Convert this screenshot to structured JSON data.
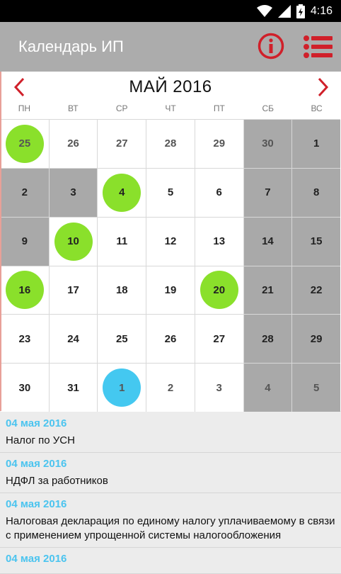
{
  "status_bar": {
    "time": "4:16"
  },
  "app_bar": {
    "title": "Календарь ИП",
    "accent": "#d0202a"
  },
  "calendar": {
    "month_title": "МАЙ 2016",
    "weekdays": [
      "ПН",
      "ВТ",
      "СР",
      "ЧТ",
      "ПТ",
      "СБ",
      "ВС"
    ],
    "colors": {
      "green": "#8ae02b",
      "blue": "#44c8f0",
      "gray": "#a9a9a9"
    },
    "weeks": [
      [
        {
          "d": "25",
          "gray": false,
          "other": true,
          "mark": "green"
        },
        {
          "d": "26",
          "gray": false,
          "other": true,
          "mark": null
        },
        {
          "d": "27",
          "gray": false,
          "other": true,
          "mark": null
        },
        {
          "d": "28",
          "gray": false,
          "other": true,
          "mark": null
        },
        {
          "d": "29",
          "gray": false,
          "other": true,
          "mark": null
        },
        {
          "d": "30",
          "gray": true,
          "other": true,
          "mark": null
        },
        {
          "d": "1",
          "gray": true,
          "other": false,
          "mark": null
        }
      ],
      [
        {
          "d": "2",
          "gray": true,
          "other": false,
          "mark": null
        },
        {
          "d": "3",
          "gray": true,
          "other": false,
          "mark": null
        },
        {
          "d": "4",
          "gray": false,
          "other": false,
          "mark": "green"
        },
        {
          "d": "5",
          "gray": false,
          "other": false,
          "mark": null
        },
        {
          "d": "6",
          "gray": false,
          "other": false,
          "mark": null
        },
        {
          "d": "7",
          "gray": true,
          "other": false,
          "mark": null
        },
        {
          "d": "8",
          "gray": true,
          "other": false,
          "mark": null
        }
      ],
      [
        {
          "d": "9",
          "gray": true,
          "other": false,
          "mark": null
        },
        {
          "d": "10",
          "gray": false,
          "other": false,
          "mark": "green"
        },
        {
          "d": "11",
          "gray": false,
          "other": false,
          "mark": null
        },
        {
          "d": "12",
          "gray": false,
          "other": false,
          "mark": null
        },
        {
          "d": "13",
          "gray": false,
          "other": false,
          "mark": null
        },
        {
          "d": "14",
          "gray": true,
          "other": false,
          "mark": null
        },
        {
          "d": "15",
          "gray": true,
          "other": false,
          "mark": null
        }
      ],
      [
        {
          "d": "16",
          "gray": false,
          "other": false,
          "mark": "green"
        },
        {
          "d": "17",
          "gray": false,
          "other": false,
          "mark": null
        },
        {
          "d": "18",
          "gray": false,
          "other": false,
          "mark": null
        },
        {
          "d": "19",
          "gray": false,
          "other": false,
          "mark": null
        },
        {
          "d": "20",
          "gray": false,
          "other": false,
          "mark": "green"
        },
        {
          "d": "21",
          "gray": true,
          "other": false,
          "mark": null
        },
        {
          "d": "22",
          "gray": true,
          "other": false,
          "mark": null
        }
      ],
      [
        {
          "d": "23",
          "gray": false,
          "other": false,
          "mark": null
        },
        {
          "d": "24",
          "gray": false,
          "other": false,
          "mark": null
        },
        {
          "d": "25",
          "gray": false,
          "other": false,
          "mark": null
        },
        {
          "d": "26",
          "gray": false,
          "other": false,
          "mark": null
        },
        {
          "d": "27",
          "gray": false,
          "other": false,
          "mark": null
        },
        {
          "d": "28",
          "gray": true,
          "other": false,
          "mark": null
        },
        {
          "d": "29",
          "gray": true,
          "other": false,
          "mark": null
        }
      ],
      [
        {
          "d": "30",
          "gray": false,
          "other": false,
          "mark": null
        },
        {
          "d": "31",
          "gray": false,
          "other": false,
          "mark": null
        },
        {
          "d": "1",
          "gray": false,
          "other": true,
          "mark": "blue"
        },
        {
          "d": "2",
          "gray": false,
          "other": true,
          "mark": null
        },
        {
          "d": "3",
          "gray": false,
          "other": true,
          "mark": null
        },
        {
          "d": "4",
          "gray": true,
          "other": true,
          "mark": null
        },
        {
          "d": "5",
          "gray": true,
          "other": true,
          "mark": null
        }
      ]
    ]
  },
  "events": [
    {
      "date": "04 мая 2016",
      "text": "Налог по УСН"
    },
    {
      "date": "04 мая 2016",
      "text": "НДФЛ за работников"
    },
    {
      "date": "04 мая 2016",
      "text": "Налоговая декларация по единому налогу уплачиваемому в связи с применением упрощенной системы налогообложения"
    },
    {
      "date": "04 мая 2016",
      "text": ""
    }
  ]
}
